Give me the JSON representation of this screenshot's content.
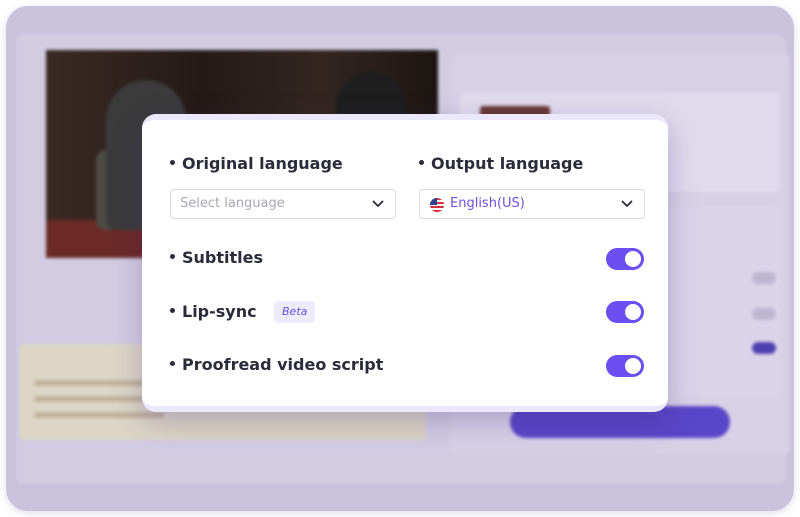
{
  "modal": {
    "original_language": {
      "label": "Original language",
      "placeholder": "Select language"
    },
    "output_language": {
      "label": "Output language",
      "value": "English(US)",
      "flag": "us-flag-icon"
    },
    "options": [
      {
        "label": "Subtitles",
        "enabled": true
      },
      {
        "label": "Lip-sync",
        "badge": "Beta",
        "enabled": true
      },
      {
        "label": "Proofread video script",
        "enabled": true
      }
    ]
  },
  "colors": {
    "accent": "#6c4ff0",
    "text": "#2b2b3a",
    "placeholder": "#a8a8b2",
    "badge_bg": "#eeebff"
  }
}
